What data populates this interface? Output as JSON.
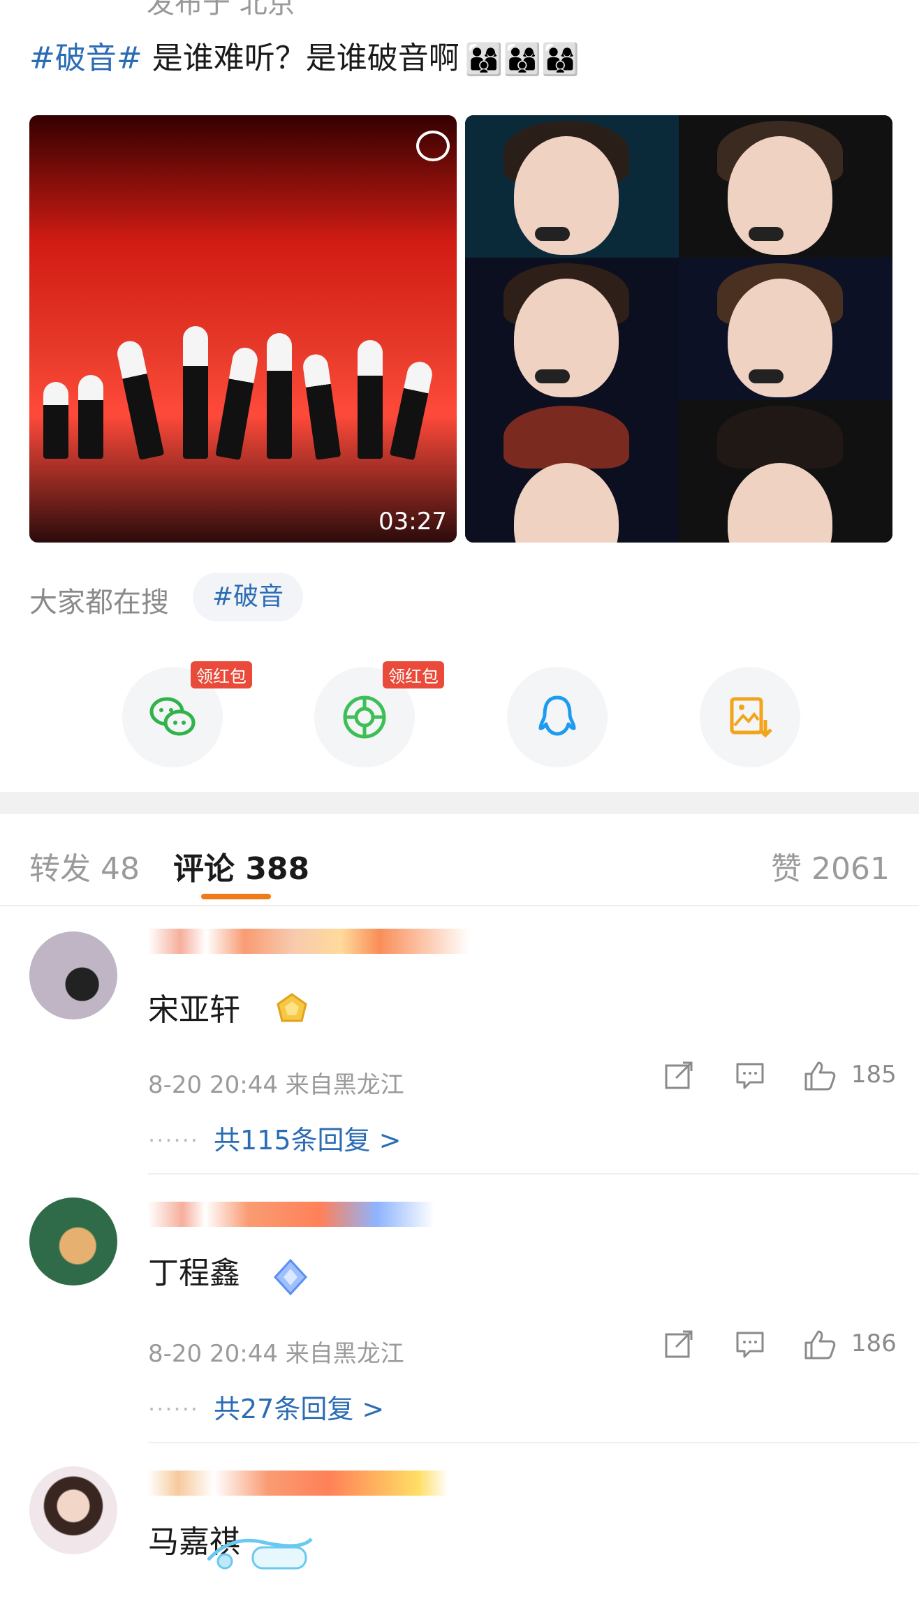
{
  "post": {
    "top_cut_text": "发布于 北京",
    "hashtag": "#破音#",
    "text": " 是谁难听？是谁破音啊",
    "emoji": "👨‍👩‍👦👨‍👩‍👦👨‍👩‍👦"
  },
  "media": {
    "video_duration": "03:27"
  },
  "search": {
    "label": "大家都在搜",
    "chip": "#破音"
  },
  "share": {
    "wechat_tag": "领红包",
    "moments_tag": "领红包"
  },
  "tabs": {
    "repost": "转发 48",
    "comment": "评论 388",
    "like": "赞 2061"
  },
  "comments": [
    {
      "text": "宋亚轩",
      "meta": "8-20 20:44  来自黑龙江",
      "likes": "185",
      "replies": "共115条回复 >"
    },
    {
      "text": "丁程鑫",
      "meta": "8-20 20:44  来自黑龙江",
      "likes": "186",
      "replies": "共27条回复 >"
    },
    {
      "text": "马嘉祺"
    }
  ],
  "colors": {
    "link": "#2b6cb5",
    "accent": "#f07a18",
    "tag_red": "#e94a3a"
  }
}
